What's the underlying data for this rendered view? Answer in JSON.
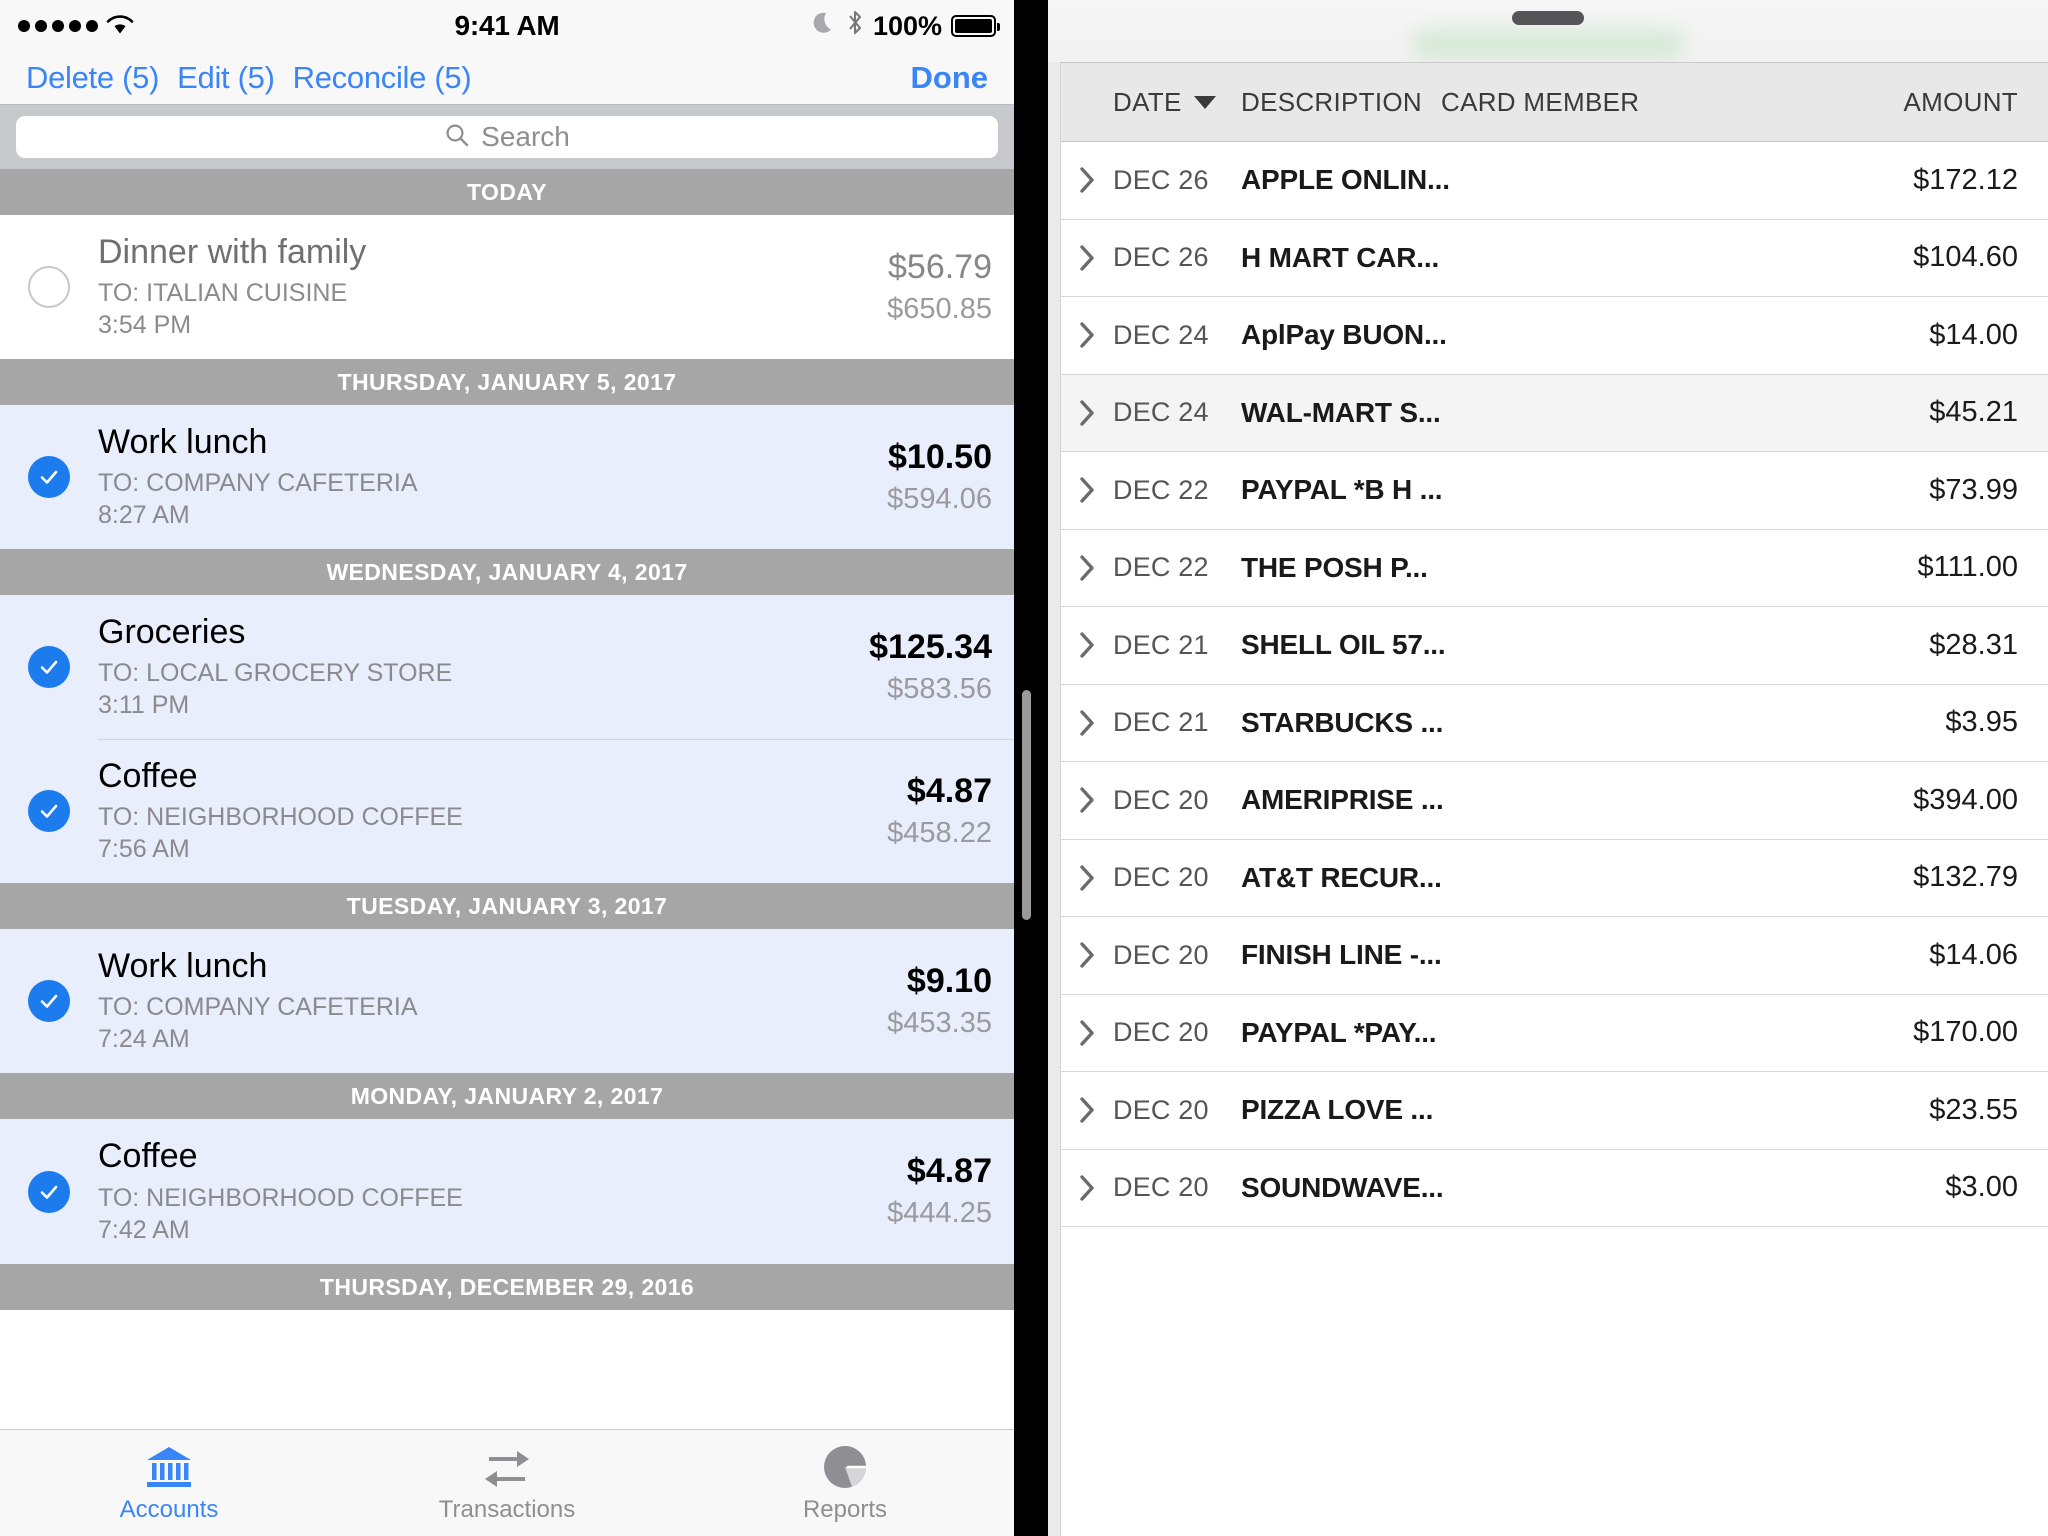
{
  "left_panel": {
    "status_bar": {
      "signal_icon": "signal-dots-icon",
      "wifi_icon": "wifi-icon",
      "time": "9:41 AM",
      "moon_icon": "moon-icon",
      "bluetooth_icon": "bluetooth-icon",
      "battery_percent": "100%",
      "battery_icon": "battery-full-icon"
    },
    "nav_bar": {
      "actions": [
        {
          "label": "Delete (5)",
          "name": "delete-button"
        },
        {
          "label": "Edit (5)",
          "name": "edit-button"
        },
        {
          "label": "Reconcile (5)",
          "name": "reconcile-button"
        }
      ],
      "done_label": "Done"
    },
    "search": {
      "icon": "search-icon",
      "placeholder": "Search",
      "value": ""
    },
    "sections": [
      {
        "header": "TODAY",
        "rows": [
          {
            "checked": false,
            "title": "Dinner with family",
            "payee": "TO: ITALIAN CUISINE",
            "time": "3:54 PM",
            "amount": "$56.79",
            "balance": "$650.85",
            "muted": true
          }
        ]
      },
      {
        "header": "THURSDAY, JANUARY 5, 2017",
        "rows": [
          {
            "checked": true,
            "title": "Work lunch",
            "payee": "TO: COMPANY CAFETERIA",
            "time": "8:27 AM",
            "amount": "$10.50",
            "balance": "$594.06",
            "muted": false
          }
        ]
      },
      {
        "header": "WEDNESDAY, JANUARY 4, 2017",
        "rows": [
          {
            "checked": true,
            "title": "Groceries",
            "payee": "TO: LOCAL GROCERY STORE",
            "time": "3:11 PM",
            "amount": "$125.34",
            "balance": "$583.56",
            "muted": false
          },
          {
            "checked": true,
            "title": "Coffee",
            "payee": "TO: NEIGHBORHOOD COFFEE",
            "time": "7:56 AM",
            "amount": "$4.87",
            "balance": "$458.22",
            "muted": false,
            "divider": true
          }
        ]
      },
      {
        "header": "TUESDAY, JANUARY 3, 2017",
        "rows": [
          {
            "checked": true,
            "title": "Work lunch",
            "payee": "TO: COMPANY CAFETERIA",
            "time": "7:24 AM",
            "amount": "$9.10",
            "balance": "$453.35",
            "muted": false
          }
        ]
      },
      {
        "header": "MONDAY, JANUARY 2, 2017",
        "rows": [
          {
            "checked": true,
            "title": "Coffee",
            "payee": "TO: NEIGHBORHOOD COFFEE",
            "time": "7:42 AM",
            "amount": "$4.87",
            "balance": "$444.25",
            "muted": false
          }
        ]
      },
      {
        "header": "THURSDAY, DECEMBER 29, 2016",
        "rows": []
      }
    ],
    "tab_bar": [
      {
        "label": "Accounts",
        "icon": "bank-icon",
        "active": true
      },
      {
        "label": "Transactions",
        "icon": "transfer-arrows-icon",
        "active": false
      },
      {
        "label": "Reports",
        "icon": "pie-chart-icon",
        "active": false
      }
    ],
    "accent_color": "#3a85f7",
    "selected_row_color": "#e8eefb",
    "section_header_color": "#a6a6a6"
  },
  "right_panel": {
    "drag_handle_icon": "drag-handle-icon",
    "blurred_title_placeholder": "",
    "table": {
      "columns": [
        "DATE",
        "DESCRIPTION",
        "CARD MEMBER",
        "AMOUNT"
      ],
      "sort_column": "DATE",
      "sort_direction": "desc",
      "sort_icon": "caret-down-icon",
      "row_expand_icon": "chevron-right-icon",
      "rows": [
        {
          "date": "DEC 26",
          "description": "APPLE ONLIN...",
          "card_member": "",
          "amount": "$172.12",
          "highlighted": false
        },
        {
          "date": "DEC 26",
          "description": "H MART CAR...",
          "card_member": "",
          "amount": "$104.60",
          "highlighted": false
        },
        {
          "date": "DEC 24",
          "description": "AplPay BUON...",
          "card_member": "",
          "amount": "$14.00",
          "highlighted": false
        },
        {
          "date": "DEC 24",
          "description": "WAL-MART S...",
          "card_member": "",
          "amount": "$45.21",
          "highlighted": true
        },
        {
          "date": "DEC 22",
          "description": "PAYPAL *B H ...",
          "card_member": "",
          "amount": "$73.99",
          "highlighted": false
        },
        {
          "date": "DEC 22",
          "description": "THE POSH P...",
          "card_member": "",
          "amount": "$111.00",
          "highlighted": false
        },
        {
          "date": "DEC 21",
          "description": "SHELL OIL 57...",
          "card_member": "",
          "amount": "$28.31",
          "highlighted": false
        },
        {
          "date": "DEC 21",
          "description": "STARBUCKS ...",
          "card_member": "",
          "amount": "$3.95",
          "highlighted": false
        },
        {
          "date": "DEC 20",
          "description": "AMERIPRISE ...",
          "card_member": "",
          "amount": "$394.00",
          "highlighted": false
        },
        {
          "date": "DEC 20",
          "description": "AT&T RECUR...",
          "card_member": "",
          "amount": "$132.79",
          "highlighted": false
        },
        {
          "date": "DEC 20",
          "description": "FINISH LINE -...",
          "card_member": "",
          "amount": "$14.06",
          "highlighted": false
        },
        {
          "date": "DEC 20",
          "description": "PAYPAL *PAY...",
          "card_member": "",
          "amount": "$170.00",
          "highlighted": false
        },
        {
          "date": "DEC 20",
          "description": "PIZZA LOVE ...",
          "card_member": "",
          "amount": "$23.55",
          "highlighted": false
        },
        {
          "date": "DEC 20",
          "description": "SOUNDWAVE...",
          "card_member": "",
          "amount": "$3.00",
          "highlighted": false
        }
      ]
    }
  }
}
